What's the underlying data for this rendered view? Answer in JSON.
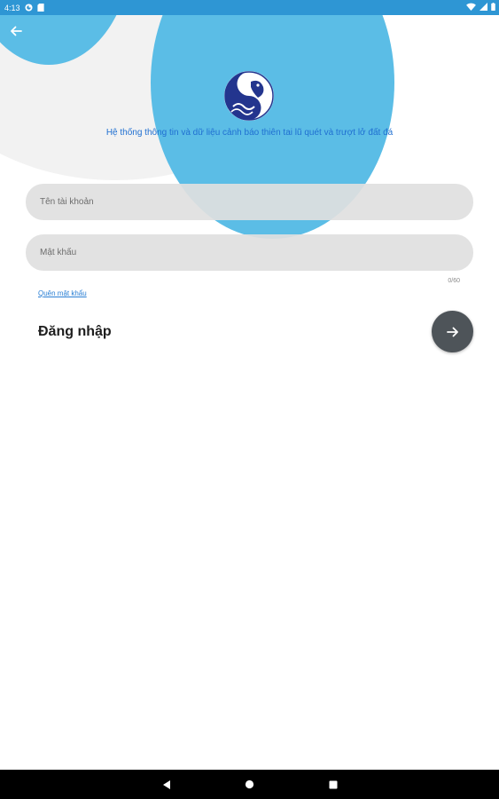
{
  "status_bar": {
    "time": "4:13",
    "icons": [
      "app-icon",
      "sd-card-icon",
      "wifi-icon",
      "signal-icon",
      "battery-icon"
    ]
  },
  "header": {
    "back_icon": "arrow-left-icon",
    "logo": "vnf-logo",
    "subtitle": "Hệ thống thông tin và dữ liệu cảnh báo thiên tai lũ quét và trượt lở đất đá"
  },
  "form": {
    "username": {
      "placeholder": "Tên tài khoản",
      "value": ""
    },
    "password": {
      "placeholder": "Mật khẩu",
      "value": "",
      "counter": "0/60"
    },
    "forgot_password": "Quên mật khẩu",
    "login_title": "Đăng nhập",
    "login_button_icon": "arrow-right-icon"
  },
  "colors": {
    "status_bar": "#2e96d4",
    "accent_circle": "#5bbde6",
    "grey_circle": "#f2f2f2",
    "link": "#2a7fd4",
    "login_button": "#4e5459"
  },
  "nav_bar": {
    "buttons": [
      "back-triangle-icon",
      "home-circle-icon",
      "recents-square-icon"
    ]
  }
}
